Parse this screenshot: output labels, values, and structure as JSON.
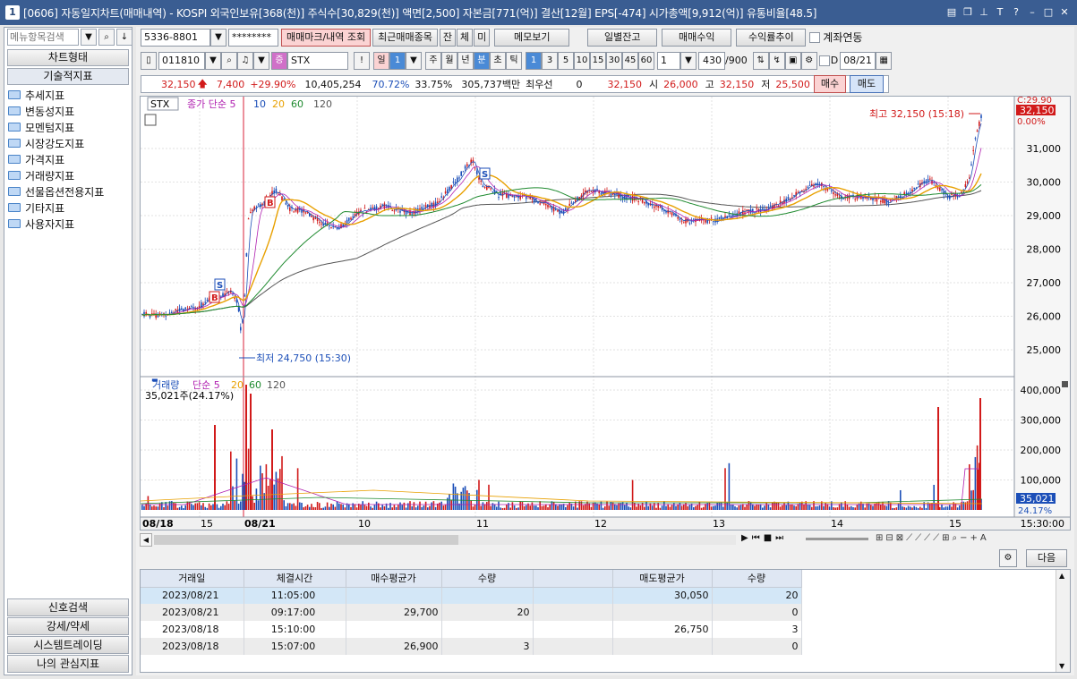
{
  "window": {
    "title": "[0606] 자동일지차트(매매내역) - KOSPI 외국인보유[368(천)] 주식수[30,829(천)] 액면[2,500] 자본금[771(억)] 결산[12월] EPS[-474] 시가총액[9,912(억)] 유통비율[48.5]",
    "icon_label": "1"
  },
  "sidebar": {
    "search_placeholder": "메뉴항목검색",
    "tabs": [
      "차트형태",
      "기술적지표"
    ],
    "tree": [
      "추세지표",
      "변동성지표",
      "모멘텀지표",
      "시장강도지표",
      "가격지표",
      "거래량지표",
      "선물옵션전용지표",
      "기타지표",
      "사용자지표"
    ],
    "bottom": [
      "신호검색",
      "강세/약세",
      "시스템트레이딩",
      "나의 관심지표"
    ]
  },
  "toolbar1": {
    "account": "5336-8801",
    "password": "********",
    "view_btn": "매매마크/내역 조회",
    "recent_btn": "최근매매종목",
    "jan": "잔",
    "che": "체",
    "mi": "미",
    "memo": "메모보기",
    "daily": "일별잔고",
    "profit": "매매수익",
    "trend": "수익률추이",
    "link_label": "계좌연동"
  },
  "toolbar2": {
    "code": "011810",
    "name": "STX",
    "excl": "!",
    "il": "일",
    "il_val": "1",
    "periods": [
      "주",
      "월",
      "년",
      "분",
      "초",
      "틱"
    ],
    "minutes": [
      "1",
      "3",
      "5",
      "10",
      "15",
      "30",
      "45",
      "60"
    ],
    "count_sel": "1",
    "bars": "430",
    "total": "/900",
    "date": "08/21"
  },
  "price": {
    "current": "32,150",
    "change": "7,400",
    "pct": "+29.90%",
    "volume": "10,405,254",
    "vol_pct": "70.72%",
    "ratio": "33.75%",
    "amount": "305,737백만",
    "prio_label": "최우선",
    "prio": "0",
    "ask": "32,150",
    "open_label": "시",
    "open": "26,000",
    "high_label": "고",
    "high": "32,150",
    "low_label": "저",
    "low": "25,500",
    "buy": "매수",
    "sell": "매도"
  },
  "chart": {
    "legend_code": "STX",
    "legend_ma": "종가 단순 5",
    "ma_periods": [
      "10",
      "20",
      "60",
      "120"
    ],
    "high_label": "최고 32,150 (15:18)",
    "low_label": "최저 24,750 (15:30)",
    "price_ticks": [
      "31,000",
      "30,000",
      "29,000",
      "28,000",
      "27,000",
      "26,000",
      "25,000"
    ],
    "last_price": "32,150",
    "pct_label": "0.00%",
    "top_label": "C:29.90",
    "vol_legend": "거래량",
    "vol_ma": "단순 5",
    "vol_ma_periods": [
      "20",
      "60",
      "120"
    ],
    "vol_info": "35,021주(24.17%)",
    "vol_ticks": [
      "400,000",
      "300,000",
      "200,000",
      "100,000"
    ],
    "vol_last": "35,021",
    "vol_last_pct": "24.17%",
    "time_labels": [
      "08/18",
      "15",
      "08/21",
      "10",
      "11",
      "12",
      "13",
      "14",
      "15"
    ],
    "time_current": "15:30:00"
  },
  "table": {
    "headers": [
      "거래일",
      "체결시간",
      "매수평균가",
      "수량",
      "",
      "매도평균가",
      "수량"
    ],
    "rows": [
      [
        "2023/08/21",
        "11:05:00",
        "",
        "",
        "",
        "30,050",
        "20"
      ],
      [
        "2023/08/21",
        "09:17:00",
        "29,700",
        "20",
        "",
        "",
        "0"
      ],
      [
        "2023/08/18",
        "15:10:00",
        "",
        "",
        "",
        "26,750",
        "3"
      ],
      [
        "2023/08/18",
        "15:07:00",
        "26,900",
        "3",
        "",
        "",
        "0"
      ]
    ],
    "next": "다음"
  },
  "colors": {
    "up": "#d11a1a",
    "down": "#1c4fb8",
    "title": "#3a5d92"
  }
}
